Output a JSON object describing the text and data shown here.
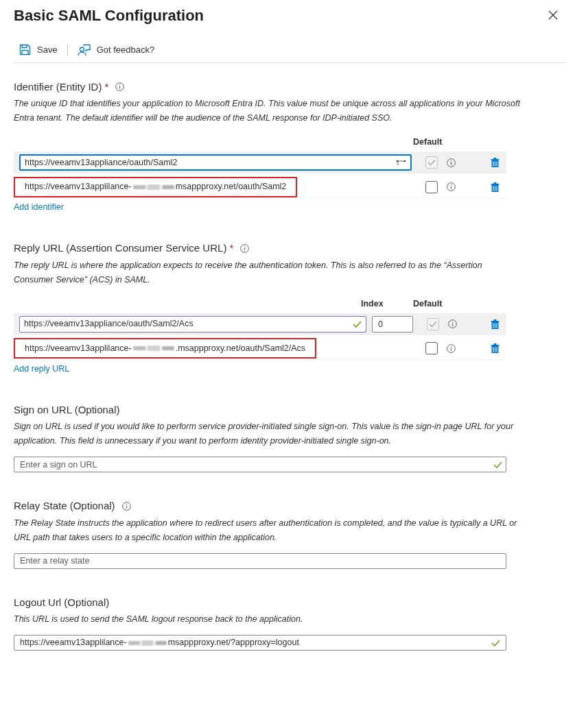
{
  "title": "Basic SAML Configuration",
  "toolbar": [
    {
      "kind": "save",
      "label": "Save"
    },
    {
      "kind": "feedback",
      "label": "Got feedback?"
    }
  ],
  "sections": [
    {
      "kind": "table",
      "label": "Identifier (Entity ID)",
      "required_mark": "*",
      "info": true,
      "description": "The unique ID that identifies your application to Microsoft Entra ID. This value must be unique across all applications in your Microsoft Entra tenant. The default identifier will be the audience of the SAML response for IDP-initiated SSO.",
      "columns": [
        "Default"
      ],
      "rows": [
        {
          "kind": "input",
          "value": "https://veeamv13appliance/oauth/Saml2",
          "focused": true,
          "valid": false,
          "keyhint": true,
          "default_checked": true,
          "default_disabled": true
        },
        {
          "kind": "text",
          "prefix": "https://veeamv13applilance-",
          "suffix": "msappproxy.net/oauth/Saml2",
          "highlighted": true,
          "default_checked": false,
          "default_disabled": false
        }
      ],
      "add_link": "Add identifier"
    },
    {
      "kind": "table",
      "label": "Reply URL (Assertion Consumer Service URL)",
      "required_mark": "*",
      "info": true,
      "description": "The reply URL is where the application expects to receive the authentication token. This is also referred to as the “Assertion Consumer Service” (ACS) in SAML.",
      "columns": [
        "Index",
        "Default"
      ],
      "rows": [
        {
          "kind": "input",
          "value": "https://veeamv13appliance/oauth/Saml2/Acs",
          "focused": false,
          "valid": true,
          "keyhint": false,
          "index": "0",
          "default_checked": true,
          "default_disabled": true
        },
        {
          "kind": "text",
          "prefix": "https://veeamv13applilance-",
          "suffix": ".msappproxy.net/oauth/Saml2/Acs",
          "highlighted": true,
          "default_checked": false,
          "default_disabled": false
        }
      ],
      "add_link": "Add reply URL"
    },
    {
      "kind": "field",
      "label": "Sign on URL (Optional)",
      "description": "Sign on URL is used if you would like to perform service provider-initiated single sign-on. This value is the sign-in page URL for your application. This field is unnecessary if you want to perform identity provider-initiated single sign-on.",
      "placeholder": "Enter a sign on URL",
      "valid": true
    },
    {
      "kind": "field",
      "label": "Relay State (Optional)",
      "info": true,
      "description": "The Relay State instructs the application where to redirect users after authentication is completed, and the value is typically a URL or URL path that takes users to a specific location within the application.",
      "placeholder": "Enter a relay state",
      "valid": false
    },
    {
      "kind": "field",
      "label": "Logout Url (Optional)",
      "description": "This URL is used to send the SAML logout response back to the application.",
      "prefix": "https://veeamv13applilance-",
      "suffix": "msappproxy.net/?appproxy=logout",
      "valid": true
    }
  ]
}
